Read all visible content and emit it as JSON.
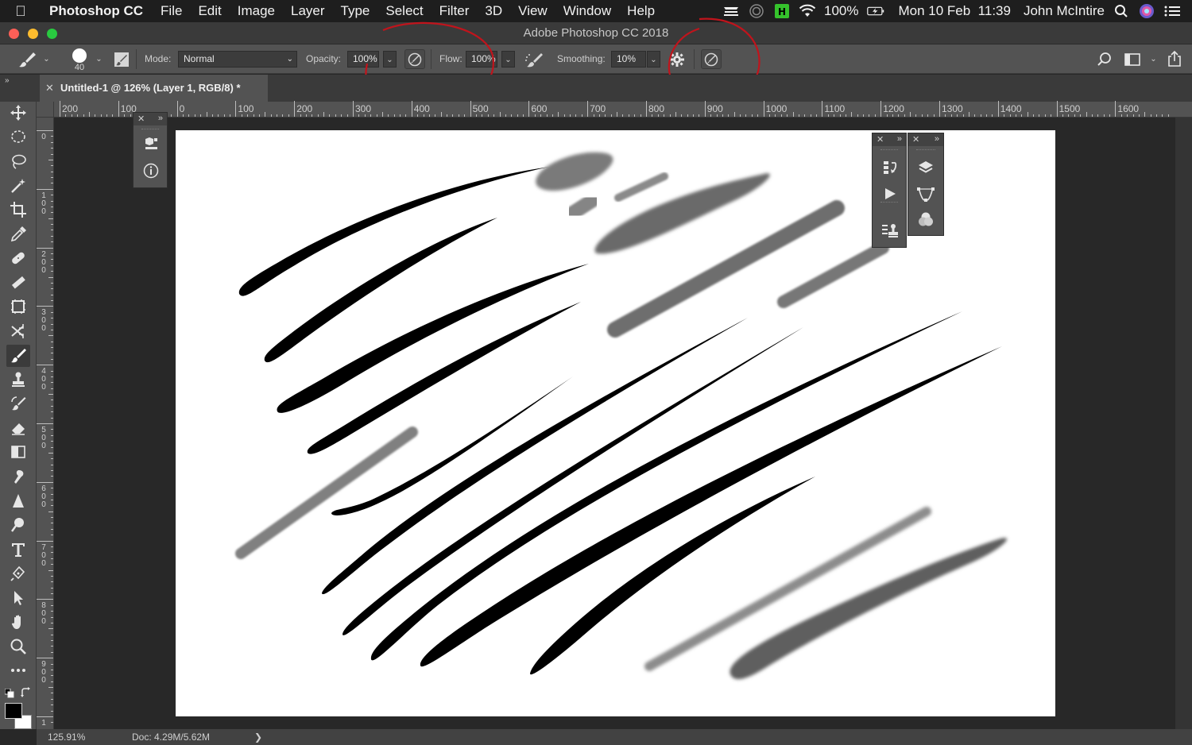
{
  "menubar": {
    "app_name": "Photoshop CC",
    "items": [
      "File",
      "Edit",
      "Image",
      "Layer",
      "Type",
      "Select",
      "Filter",
      "3D",
      "View",
      "Window",
      "Help"
    ],
    "battery": "100%",
    "datetime": "Mon 10 Feb  11:39",
    "user": "John McIntire"
  },
  "window": {
    "title": "Adobe Photoshop CC 2018"
  },
  "options": {
    "brush_size": "40",
    "mode_label": "Mode:",
    "mode_value": "Normal",
    "opacity_label": "Opacity:",
    "opacity_value": "100%",
    "flow_label": "Flow:",
    "flow_value": "100%",
    "smoothing_label": "Smoothing:",
    "smoothing_value": "10%"
  },
  "document": {
    "tab_title": "Untitled-1 @ 126% (Layer 1, RGB/8) *"
  },
  "ruler": {
    "h_labels": [
      "200",
      "100",
      "0",
      "100",
      "200",
      "300",
      "400",
      "500",
      "600",
      "700",
      "800",
      "900",
      "1000",
      "1100",
      "1200",
      "1300",
      "1400",
      "1500",
      "1600"
    ],
    "v_labels": [
      "0",
      "100",
      "200",
      "300",
      "400",
      "500",
      "600",
      "700",
      "800",
      "900",
      "1"
    ]
  },
  "status": {
    "zoom": "125.91%",
    "doc_size": "Doc: 4.29M/5.62M"
  },
  "colors": {
    "ui_dark": "#535353",
    "annotation": "#c0141c",
    "canvas": "#ffffff"
  }
}
